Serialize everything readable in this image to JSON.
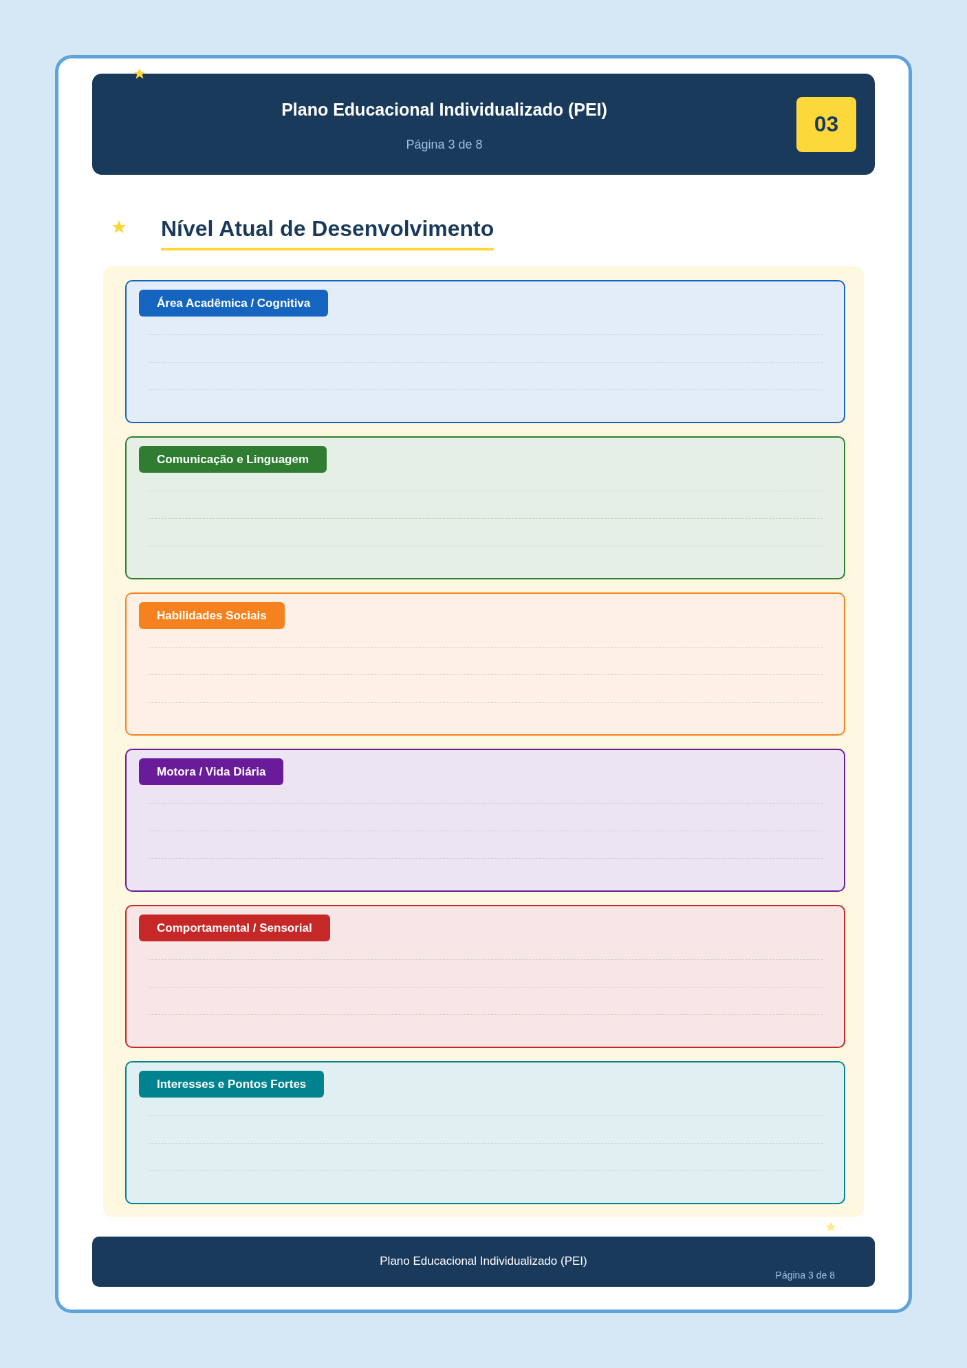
{
  "header": {
    "title": "Plano Educacional Individualizado (PEI)",
    "subtitle": "Página 3 de 8",
    "page_badge": "03"
  },
  "section": {
    "title": "Nível Atual de Desenvolvimento"
  },
  "areas": [
    {
      "label": "Área Acadêmica / Cognitiva",
      "color": "#1565c0"
    },
    {
      "label": "Comunicação e Linguagem",
      "color": "#2e7d32"
    },
    {
      "label": "Habilidades Sociais",
      "color": "#f5821f"
    },
    {
      "label": "Motora / Vida Diária",
      "color": "#6a1b9a"
    },
    {
      "label": "Comportamental / Sensorial",
      "color": "#c62828"
    },
    {
      "label": "Interesses e Pontos Fortes",
      "color": "#00838f"
    }
  ],
  "footer": {
    "title": "Plano Educacional Individualizado (PEI)",
    "page": "Página 3 de 8"
  }
}
